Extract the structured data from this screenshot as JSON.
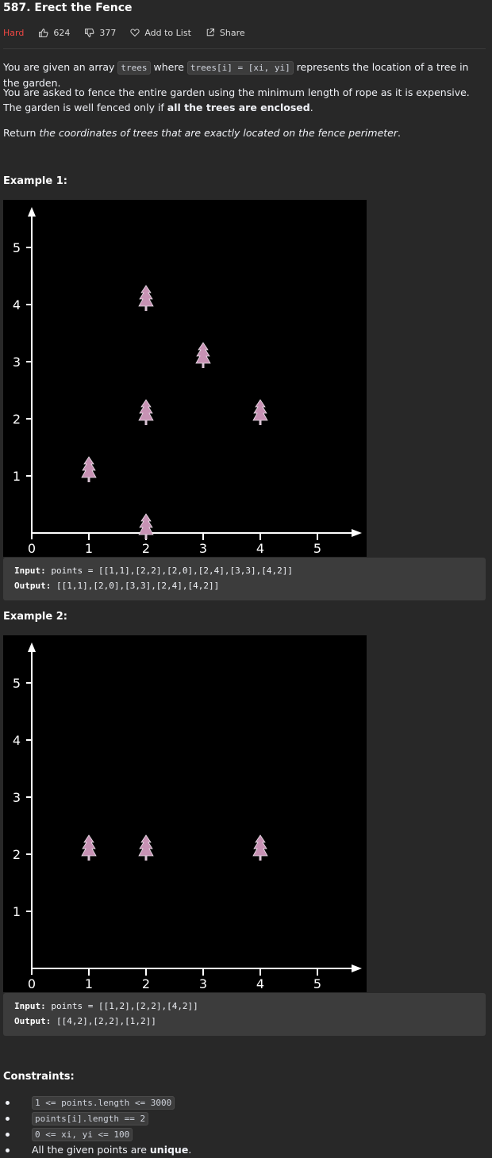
{
  "problem": {
    "title": "587. Erect the Fence",
    "difficulty": "Hard",
    "likes": "624",
    "dislikes": "377",
    "add_to_list": "Add to List",
    "share": "Share"
  },
  "description": {
    "p1_a": "You are given an array ",
    "p1_code1": "trees",
    "p1_b": " where ",
    "p1_code2": "trees[i] = [xi, yi]",
    "p1_c": " represents the location of a tree in the garden.",
    "p2_a": "You are asked to fence the entire garden using the minimum length of rope as it is expensive. The garden is well fenced only if ",
    "p2_bold": "all the trees are enclosed",
    "p2_b": ".",
    "p3_a": "Return ",
    "p3_italic": "the coordinates of trees that are exactly located on the fence perimeter",
    "p3_b": "."
  },
  "examples": [
    {
      "heading": "Example 1:",
      "input_label": "Input:",
      "input_value": " points = [[1,1],[2,2],[2,0],[2,4],[3,3],[4,2]]",
      "output_label": "Output:",
      "output_value": " [[1,1],[2,0],[3,3],[2,4],[4,2]]"
    },
    {
      "heading": "Example 2:",
      "input_label": "Input:",
      "input_value": " points = [[1,2],[2,2],[4,2]]",
      "output_label": "Output:",
      "output_value": " [[4,2],[2,2],[1,2]]"
    }
  ],
  "chart_data": [
    {
      "type": "scatter",
      "x_ticks": [
        "0",
        "1",
        "2",
        "3",
        "4",
        "5"
      ],
      "y_ticks": [
        "1",
        "2",
        "3",
        "4",
        "5"
      ],
      "points": [
        [
          1,
          1
        ],
        [
          2,
          2
        ],
        [
          2,
          0
        ],
        [
          2,
          4
        ],
        [
          3,
          3
        ],
        [
          4,
          2
        ]
      ],
      "marker": "tree-icon",
      "marker_color": "#c792b4",
      "background": "#000000"
    },
    {
      "type": "scatter",
      "x_ticks": [
        "0",
        "1",
        "2",
        "3",
        "4",
        "5"
      ],
      "y_ticks": [
        "1",
        "2",
        "3",
        "4",
        "5"
      ],
      "points": [
        [
          1,
          2
        ],
        [
          2,
          2
        ],
        [
          4,
          2
        ]
      ],
      "marker": "tree-icon",
      "marker_color": "#c792b4",
      "background": "#000000"
    }
  ],
  "constraints": {
    "heading": "Constraints:",
    "items": [
      {
        "code": "1 <= points.length <= 3000"
      },
      {
        "code": "points[i].length == 2"
      },
      {
        "code": "0 <= xi, yi <= 100"
      },
      {
        "text_a": "All the given points are ",
        "bold": "unique",
        "text_b": "."
      }
    ]
  },
  "colors": {
    "background": "#282828",
    "hard": "#ef4743",
    "code_bg": "#3c3c3c"
  }
}
